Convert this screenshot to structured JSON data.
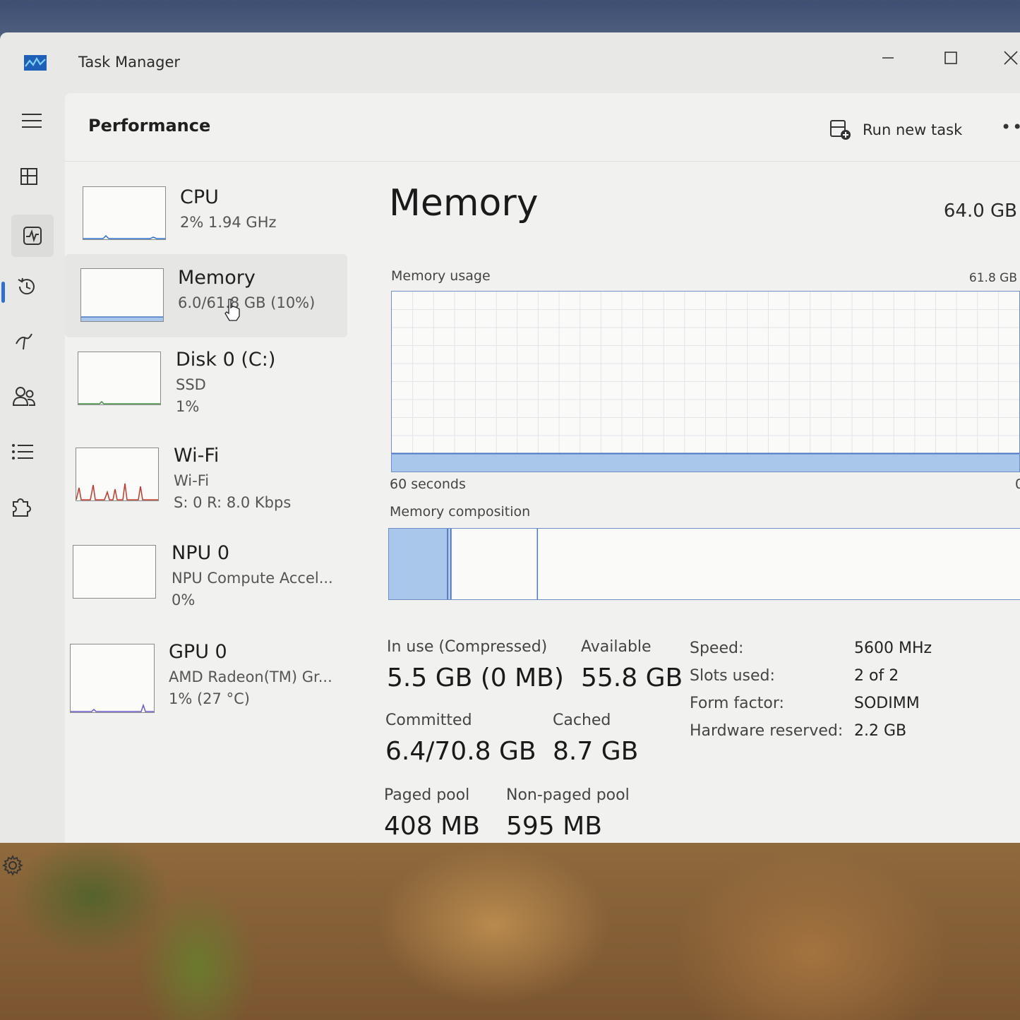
{
  "window": {
    "title": "Task Manager"
  },
  "header": {
    "page_title": "Performance",
    "run_new_task": "Run new task"
  },
  "devices": [
    {
      "name": "CPU",
      "line1": "2% 1.94 GHz",
      "line2": ""
    },
    {
      "name": "Memory",
      "line1": "6.0/61.8 GB (10%)",
      "line2": ""
    },
    {
      "name": "Disk 0 (C:)",
      "line1": "SSD",
      "line2": "1%"
    },
    {
      "name": "Wi-Fi",
      "line1": "Wi-Fi",
      "line2": "S: 0 R: 8.0 Kbps"
    },
    {
      "name": "NPU 0",
      "line1": "NPU Compute Accel...",
      "line2": "0%"
    },
    {
      "name": "GPU 0",
      "line1": "AMD Radeon(TM) Gr...",
      "line2": "1% (27 °C)"
    }
  ],
  "memory": {
    "title": "Memory",
    "total": "64.0 GB",
    "usage_label": "Memory usage",
    "usage_max": "61.8 GB",
    "time_span": "60 seconds",
    "time_end": "0",
    "usage_fraction": 0.1,
    "composition_label": "Memory composition",
    "composition": {
      "in_use_fraction": 0.093,
      "modified_fraction": 0.005,
      "standby_fraction": 0.137
    },
    "stats": {
      "in_use_label": "In use (Compressed)",
      "in_use_value": "5.5 GB (0 MB)",
      "available_label": "Available",
      "available_value": "55.8 GB",
      "committed_label": "Committed",
      "committed_value": "6.4/70.8 GB",
      "cached_label": "Cached",
      "cached_value": "8.7 GB",
      "paged_label": "Paged pool",
      "paged_value": "408 MB",
      "nonpaged_label": "Non-paged pool",
      "nonpaged_value": "595 MB"
    },
    "specs": {
      "speed_label": "Speed:",
      "speed_value": "5600 MHz",
      "slots_label": "Slots used:",
      "slots_value": "2 of 2",
      "form_label": "Form factor:",
      "form_value": "SODIMM",
      "reserved_label": "Hardware reserved:",
      "reserved_value": "2.2 GB"
    }
  },
  "colors": {
    "accent": "#2f6fcf",
    "memory_fill": "#a9c7ea",
    "memory_line": "#4a78c2",
    "wifi_line": "#c0392b",
    "disk_line": "#3f8f3f",
    "gpu_line": "#6a5acd"
  }
}
